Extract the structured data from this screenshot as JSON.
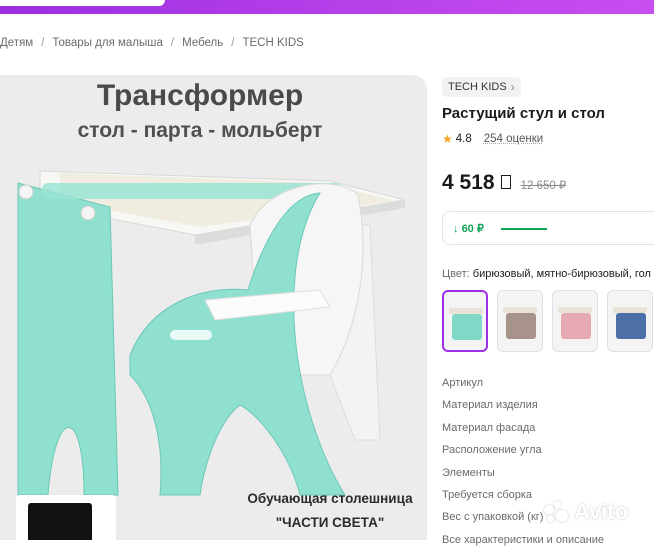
{
  "breadcrumb": [
    "Детям",
    "Товары для малыша",
    "Мебель",
    "TECH KIDS"
  ],
  "breadcrumb_sep": "/",
  "gallery": {
    "promo_title": "Трансформер",
    "promo_subtitle": "стол - парта - мольберт",
    "caption_line1": "Обучающая столешница",
    "caption_line2": "\"ЧАСТИ СВЕТА\""
  },
  "product": {
    "brand": "TECH KIDS",
    "title": "Растущий стул и стол",
    "rating": "4.8",
    "reviews": "254 оценки",
    "price": "4 518",
    "old_price": "12 650 ₽",
    "bonus": "60 ₽",
    "color_label": "Цвет:",
    "color_value": "бирюзовый, мятно-бирюзовый, гол"
  },
  "swatches": [
    {
      "color": "#7fd8c8",
      "selected": true
    },
    {
      "color": "#a8938a",
      "selected": false
    },
    {
      "color": "#e7a9b3",
      "selected": false
    },
    {
      "color": "#4d6fa8",
      "selected": false
    }
  ],
  "specs": [
    "Артикул",
    "Материал изделия",
    "Материал фасада",
    "Расположение угла",
    "Элементы",
    "Требуется сборка",
    "Вес с упаковкой (кг)",
    "Все характеристики и описание"
  ],
  "watermark": "Avito",
  "colors": {
    "accent": "#9b30e6",
    "green": "#12a356",
    "mint": "#7fd8c8",
    "star": "#f5a623"
  }
}
